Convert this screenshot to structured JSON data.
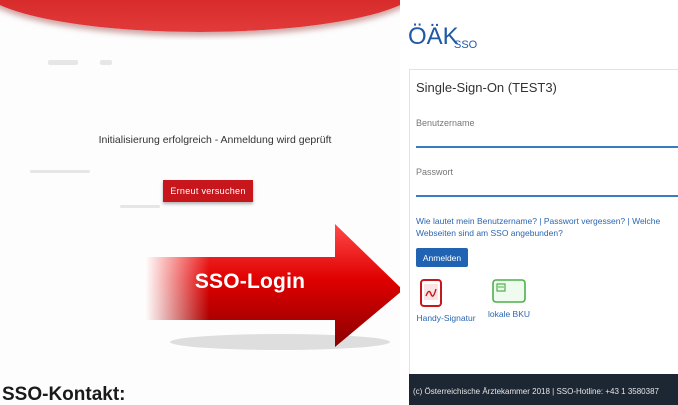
{
  "left": {
    "status_text": "Initialisierung erfolgreich - Anmeldung wird geprüft",
    "retry_label": "Erneut versuchen",
    "contact_heading": "SSO-Kontakt:"
  },
  "arrow": {
    "label": "SSO-Login"
  },
  "sso": {
    "logo_text": "ÖÄK",
    "logo_sub": "SSO",
    "title": "Single-Sign-On (TEST3)",
    "username_label": "Benutzername",
    "password_label": "Passwort",
    "help_links": "Wie lautet mein Benutzername? | Passwort vergessen? | Welche Webseiten sind am SSO angebunden?",
    "login_label": "Anmelden",
    "methods": [
      {
        "label": "Handy-Signatur",
        "icon": "phone-signature-icon"
      },
      {
        "label": "lokale BKU",
        "icon": "card-reader-icon"
      }
    ],
    "footer": "(c) Österreichische Ärztekammer 2018 | SSO-Hotline: +43 1 3580387"
  },
  "colors": {
    "brand_red": "#c8171c",
    "link_blue": "#2a66b3",
    "button_blue": "#1f63b2",
    "footer_dark": "#1d2733"
  }
}
